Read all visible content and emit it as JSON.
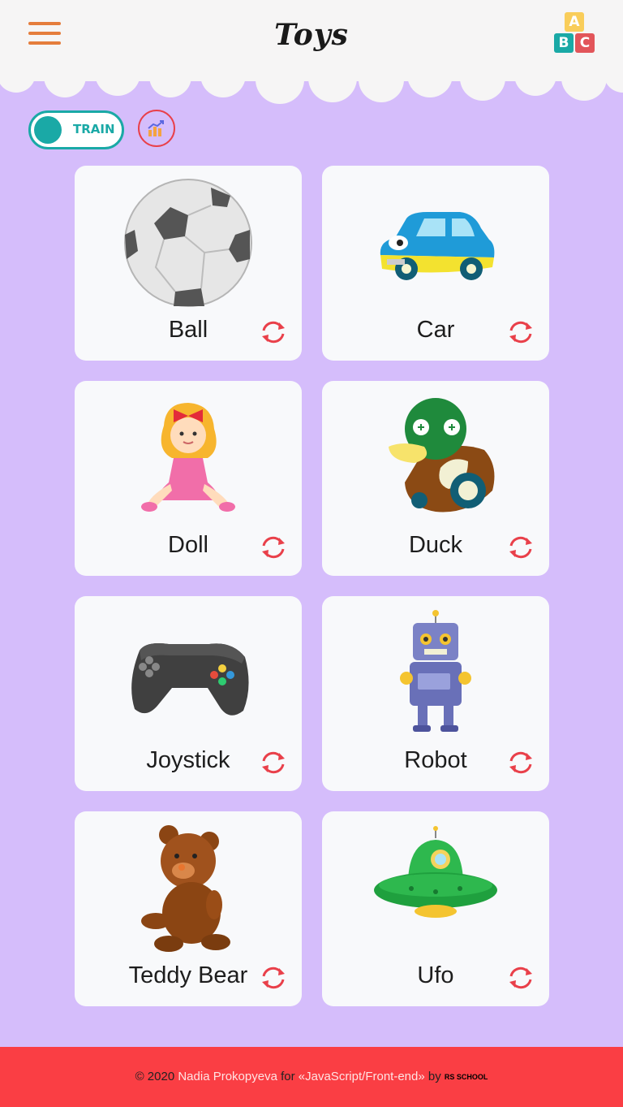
{
  "header": {
    "title": "Toys",
    "abc_letters": [
      "A",
      "B",
      "C"
    ],
    "abc_colors": [
      "#f9cd5a",
      "#1aa9a6",
      "#e2555a"
    ]
  },
  "controls": {
    "mode_label": "TRAIN",
    "accent": "#1aa9a6",
    "stats_color": "#e9404a"
  },
  "cards": [
    {
      "label": "Ball",
      "icon": "soccer-ball-icon"
    },
    {
      "label": "Car",
      "icon": "toy-car-icon"
    },
    {
      "label": "Doll",
      "icon": "doll-icon"
    },
    {
      "label": "Duck",
      "icon": "toy-duck-icon"
    },
    {
      "label": "Joystick",
      "icon": "gamepad-icon"
    },
    {
      "label": "Robot",
      "icon": "robot-icon"
    },
    {
      "label": "Teddy Bear",
      "icon": "teddy-bear-icon"
    },
    {
      "label": "Ufo",
      "icon": "ufo-icon"
    }
  ],
  "footer": {
    "copyright": "© 2020",
    "author": "Nadia Prokopyeva",
    "for_text": "for",
    "course": "«JavaScript/Front-end»",
    "by_text": "by",
    "school_logo": "RS SCHOOL"
  },
  "colors": {
    "background": "#d5bdfb",
    "header": "#f6f5f5",
    "footer": "#fa3e44",
    "menu": "#e57d3c"
  }
}
